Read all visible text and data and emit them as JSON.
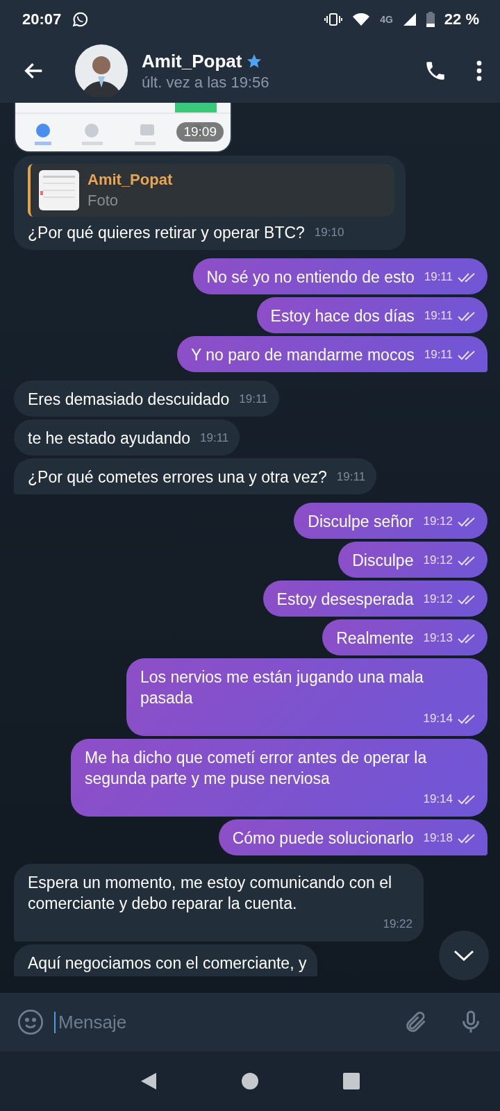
{
  "status_bar": {
    "time": "20:07",
    "network": "4G",
    "battery": "22 %"
  },
  "header": {
    "name": "Amit_Popat",
    "status": "últ. vez a las 19:56",
    "verified": true
  },
  "messages": [
    {
      "outgoing": false,
      "time": "19:09"
    },
    {
      "kind": "reply",
      "outgoing": false,
      "quote_author": "Amit_Popat",
      "quote_text": "Foto",
      "text": "¿Por qué quieres retirar y operar BTC?",
      "time": "19:10"
    },
    {
      "kind": "text",
      "outgoing": true,
      "text": "No sé yo no entiendo de esto",
      "time": "19:11",
      "read": true
    },
    {
      "kind": "text",
      "outgoing": true,
      "text": "Estoy hace dos días",
      "time": "19:11",
      "read": true
    },
    {
      "kind": "text",
      "outgoing": true,
      "text": "Y no paro de mandarme mocos",
      "time": "19:11",
      "read": true,
      "tail": true
    },
    {
      "kind": "text",
      "outgoing": false,
      "text": "Eres demasiado descuidado",
      "time": "19:11"
    },
    {
      "kind": "text",
      "outgoing": false,
      "text": "te he estado ayudando",
      "time": "19:11"
    },
    {
      "kind": "text",
      "outgoing": false,
      "text": "¿Por qué cometes errores una y otra vez?",
      "time": "19:11",
      "tail": true
    },
    {
      "kind": "text",
      "outgoing": true,
      "text": "Disculpe señor",
      "time": "19:12",
      "read": true
    },
    {
      "kind": "text",
      "outgoing": true,
      "text": "Disculpe",
      "time": "19:12",
      "read": true
    },
    {
      "kind": "text",
      "outgoing": true,
      "text": "Estoy desesperada",
      "time": "19:12",
      "read": true
    },
    {
      "kind": "text",
      "outgoing": true,
      "text": "Realmente",
      "time": "19:13",
      "read": true
    },
    {
      "kind": "long",
      "outgoing": true,
      "text": "Los nervios me están jugando una mala pasada",
      "time": "19:14",
      "read": true
    },
    {
      "kind": "long",
      "outgoing": true,
      "text": "Me ha dicho que cometí error antes de operar la segunda parte y me puse nerviosa",
      "time": "19:14",
      "read": true
    },
    {
      "kind": "text",
      "outgoing": true,
      "text": "Cómo puede solucionarlo",
      "time": "19:18",
      "read": true,
      "tail": true
    },
    {
      "kind": "long",
      "outgoing": false,
      "text": "Espera un momento, me estoy comunicando con el comerciante y debo reparar la cuenta.",
      "time": "19:22",
      "tail": true
    },
    {
      "kind": "partial",
      "outgoing": false,
      "text": "Aquí negociamos con el comerciante, y"
    }
  ],
  "composer": {
    "placeholder": "Mensaje"
  }
}
